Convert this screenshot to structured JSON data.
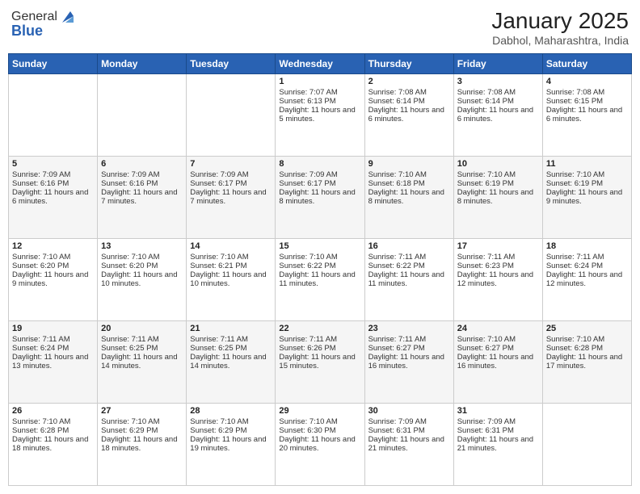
{
  "header": {
    "logo_general": "General",
    "logo_blue": "Blue",
    "month_title": "January 2025",
    "location": "Dabhol, Maharashtra, India"
  },
  "days_of_week": [
    "Sunday",
    "Monday",
    "Tuesday",
    "Wednesday",
    "Thursday",
    "Friday",
    "Saturday"
  ],
  "weeks": [
    [
      {
        "day": "",
        "sunrise": "",
        "sunset": "",
        "daylight": ""
      },
      {
        "day": "",
        "sunrise": "",
        "sunset": "",
        "daylight": ""
      },
      {
        "day": "",
        "sunrise": "",
        "sunset": "",
        "daylight": ""
      },
      {
        "day": "1",
        "sunrise": "Sunrise: 7:07 AM",
        "sunset": "Sunset: 6:13 PM",
        "daylight": "Daylight: 11 hours and 5 minutes."
      },
      {
        "day": "2",
        "sunrise": "Sunrise: 7:08 AM",
        "sunset": "Sunset: 6:14 PM",
        "daylight": "Daylight: 11 hours and 6 minutes."
      },
      {
        "day": "3",
        "sunrise": "Sunrise: 7:08 AM",
        "sunset": "Sunset: 6:14 PM",
        "daylight": "Daylight: 11 hours and 6 minutes."
      },
      {
        "day": "4",
        "sunrise": "Sunrise: 7:08 AM",
        "sunset": "Sunset: 6:15 PM",
        "daylight": "Daylight: 11 hours and 6 minutes."
      }
    ],
    [
      {
        "day": "5",
        "sunrise": "Sunrise: 7:09 AM",
        "sunset": "Sunset: 6:16 PM",
        "daylight": "Daylight: 11 hours and 6 minutes."
      },
      {
        "day": "6",
        "sunrise": "Sunrise: 7:09 AM",
        "sunset": "Sunset: 6:16 PM",
        "daylight": "Daylight: 11 hours and 7 minutes."
      },
      {
        "day": "7",
        "sunrise": "Sunrise: 7:09 AM",
        "sunset": "Sunset: 6:17 PM",
        "daylight": "Daylight: 11 hours and 7 minutes."
      },
      {
        "day": "8",
        "sunrise": "Sunrise: 7:09 AM",
        "sunset": "Sunset: 6:17 PM",
        "daylight": "Daylight: 11 hours and 8 minutes."
      },
      {
        "day": "9",
        "sunrise": "Sunrise: 7:10 AM",
        "sunset": "Sunset: 6:18 PM",
        "daylight": "Daylight: 11 hours and 8 minutes."
      },
      {
        "day": "10",
        "sunrise": "Sunrise: 7:10 AM",
        "sunset": "Sunset: 6:19 PM",
        "daylight": "Daylight: 11 hours and 8 minutes."
      },
      {
        "day": "11",
        "sunrise": "Sunrise: 7:10 AM",
        "sunset": "Sunset: 6:19 PM",
        "daylight": "Daylight: 11 hours and 9 minutes."
      }
    ],
    [
      {
        "day": "12",
        "sunrise": "Sunrise: 7:10 AM",
        "sunset": "Sunset: 6:20 PM",
        "daylight": "Daylight: 11 hours and 9 minutes."
      },
      {
        "day": "13",
        "sunrise": "Sunrise: 7:10 AM",
        "sunset": "Sunset: 6:20 PM",
        "daylight": "Daylight: 11 hours and 10 minutes."
      },
      {
        "day": "14",
        "sunrise": "Sunrise: 7:10 AM",
        "sunset": "Sunset: 6:21 PM",
        "daylight": "Daylight: 11 hours and 10 minutes."
      },
      {
        "day": "15",
        "sunrise": "Sunrise: 7:10 AM",
        "sunset": "Sunset: 6:22 PM",
        "daylight": "Daylight: 11 hours and 11 minutes."
      },
      {
        "day": "16",
        "sunrise": "Sunrise: 7:11 AM",
        "sunset": "Sunset: 6:22 PM",
        "daylight": "Daylight: 11 hours and 11 minutes."
      },
      {
        "day": "17",
        "sunrise": "Sunrise: 7:11 AM",
        "sunset": "Sunset: 6:23 PM",
        "daylight": "Daylight: 11 hours and 12 minutes."
      },
      {
        "day": "18",
        "sunrise": "Sunrise: 7:11 AM",
        "sunset": "Sunset: 6:24 PM",
        "daylight": "Daylight: 11 hours and 12 minutes."
      }
    ],
    [
      {
        "day": "19",
        "sunrise": "Sunrise: 7:11 AM",
        "sunset": "Sunset: 6:24 PM",
        "daylight": "Daylight: 11 hours and 13 minutes."
      },
      {
        "day": "20",
        "sunrise": "Sunrise: 7:11 AM",
        "sunset": "Sunset: 6:25 PM",
        "daylight": "Daylight: 11 hours and 14 minutes."
      },
      {
        "day": "21",
        "sunrise": "Sunrise: 7:11 AM",
        "sunset": "Sunset: 6:25 PM",
        "daylight": "Daylight: 11 hours and 14 minutes."
      },
      {
        "day": "22",
        "sunrise": "Sunrise: 7:11 AM",
        "sunset": "Sunset: 6:26 PM",
        "daylight": "Daylight: 11 hours and 15 minutes."
      },
      {
        "day": "23",
        "sunrise": "Sunrise: 7:11 AM",
        "sunset": "Sunset: 6:27 PM",
        "daylight": "Daylight: 11 hours and 16 minutes."
      },
      {
        "day": "24",
        "sunrise": "Sunrise: 7:10 AM",
        "sunset": "Sunset: 6:27 PM",
        "daylight": "Daylight: 11 hours and 16 minutes."
      },
      {
        "day": "25",
        "sunrise": "Sunrise: 7:10 AM",
        "sunset": "Sunset: 6:28 PM",
        "daylight": "Daylight: 11 hours and 17 minutes."
      }
    ],
    [
      {
        "day": "26",
        "sunrise": "Sunrise: 7:10 AM",
        "sunset": "Sunset: 6:28 PM",
        "daylight": "Daylight: 11 hours and 18 minutes."
      },
      {
        "day": "27",
        "sunrise": "Sunrise: 7:10 AM",
        "sunset": "Sunset: 6:29 PM",
        "daylight": "Daylight: 11 hours and 18 minutes."
      },
      {
        "day": "28",
        "sunrise": "Sunrise: 7:10 AM",
        "sunset": "Sunset: 6:29 PM",
        "daylight": "Daylight: 11 hours and 19 minutes."
      },
      {
        "day": "29",
        "sunrise": "Sunrise: 7:10 AM",
        "sunset": "Sunset: 6:30 PM",
        "daylight": "Daylight: 11 hours and 20 minutes."
      },
      {
        "day": "30",
        "sunrise": "Sunrise: 7:09 AM",
        "sunset": "Sunset: 6:31 PM",
        "daylight": "Daylight: 11 hours and 21 minutes."
      },
      {
        "day": "31",
        "sunrise": "Sunrise: 7:09 AM",
        "sunset": "Sunset: 6:31 PM",
        "daylight": "Daylight: 11 hours and 21 minutes."
      },
      {
        "day": "",
        "sunrise": "",
        "sunset": "",
        "daylight": ""
      }
    ]
  ]
}
